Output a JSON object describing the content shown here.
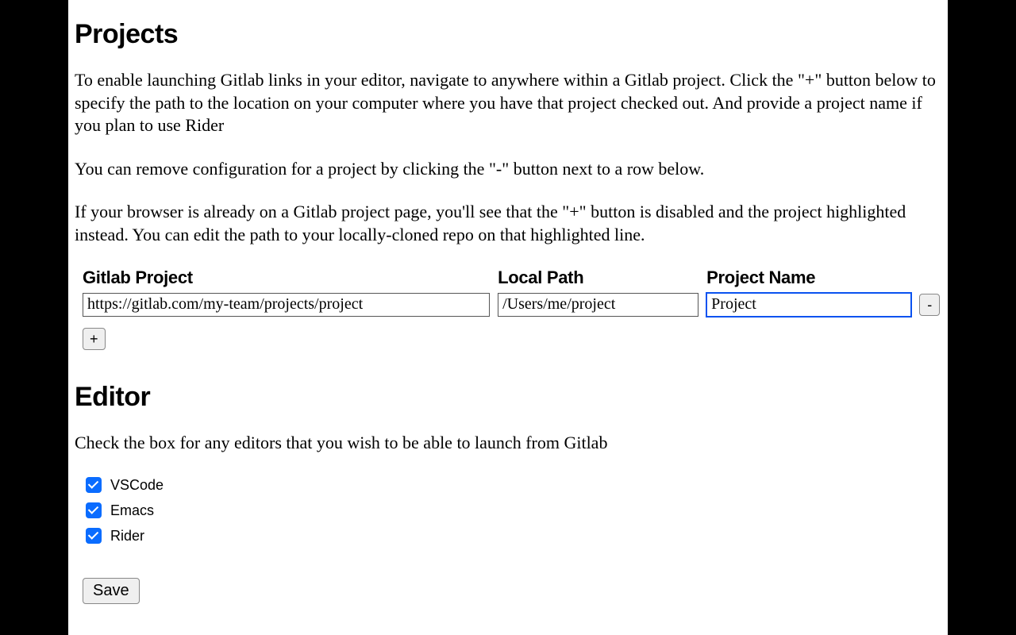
{
  "projects": {
    "heading": "Projects",
    "intro1": "To enable launching Gitlab links in your editor, navigate to anywhere within a Gitlab project. Click the \"+\" button below to specify the path to the location on your computer where you have that project checked out. And provide a project name if you plan to use Rider",
    "intro2": "You can remove configuration for a project by clicking the \"-\" button next to a row below.",
    "intro3": "If your browser is already on a Gitlab project page, you'll see that the \"+\" button is disabled and the project highlighted instead. You can edit the path to your locally-cloned repo on that highlighted line.",
    "columns": {
      "gitlab": "Gitlab Project",
      "local": "Local Path",
      "name": "Project Name"
    },
    "rows": [
      {
        "gitlab": "https://gitlab.com/my-team/projects/project",
        "local": "/Users/me/project",
        "name": "Project"
      }
    ],
    "remove_label": "-",
    "add_label": "+"
  },
  "editor": {
    "heading": "Editor",
    "intro": "Check the box for any editors that you wish to be able to launch from Gitlab",
    "options": [
      {
        "label": "VSCode",
        "checked": true
      },
      {
        "label": "Emacs",
        "checked": true
      },
      {
        "label": "Rider",
        "checked": true
      }
    ]
  },
  "save_label": "Save"
}
